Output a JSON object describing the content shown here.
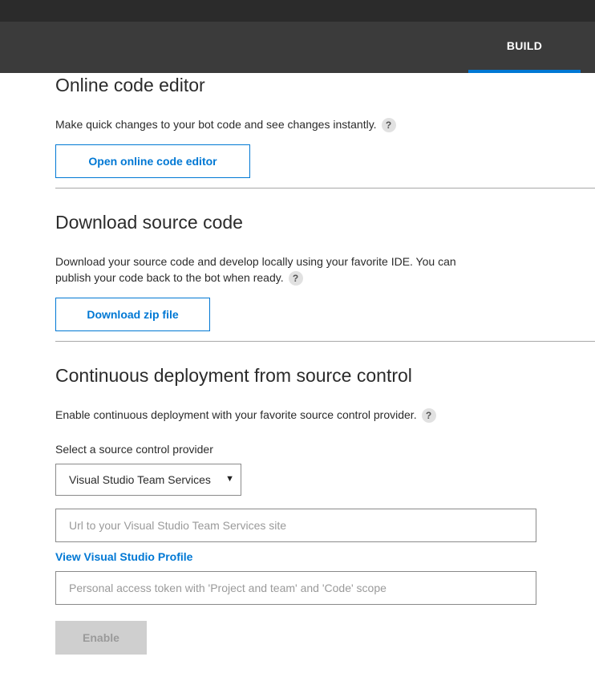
{
  "nav": {
    "active_tab": "BUILD"
  },
  "sections": {
    "online_editor": {
      "title": "Online code editor",
      "description": "Make quick changes to your bot code and see changes instantly.",
      "button_label": "Open online code editor"
    },
    "download": {
      "title": "Download source code",
      "description_line1": "Download your source code and develop locally using your favorite IDE. You can",
      "description_line2": "publish your code back to the bot when ready.",
      "button_label": "Download zip file"
    },
    "continuous": {
      "title": "Continuous deployment from source control",
      "description": "Enable continuous deployment with your favorite source control provider.",
      "provider_label": "Select a source control provider",
      "provider_selected": "Visual Studio Team Services",
      "url_placeholder": "Url to your Visual Studio Team Services site",
      "profile_link": "View Visual Studio Profile",
      "token_placeholder": "Personal access token with 'Project and team' and 'Code' scope",
      "enable_label": "Enable"
    }
  },
  "help_glyph": "?",
  "colors": {
    "accent": "#0078d4",
    "nav_bg": "#3b3b3b",
    "top_bg": "#2b2b2b"
  }
}
